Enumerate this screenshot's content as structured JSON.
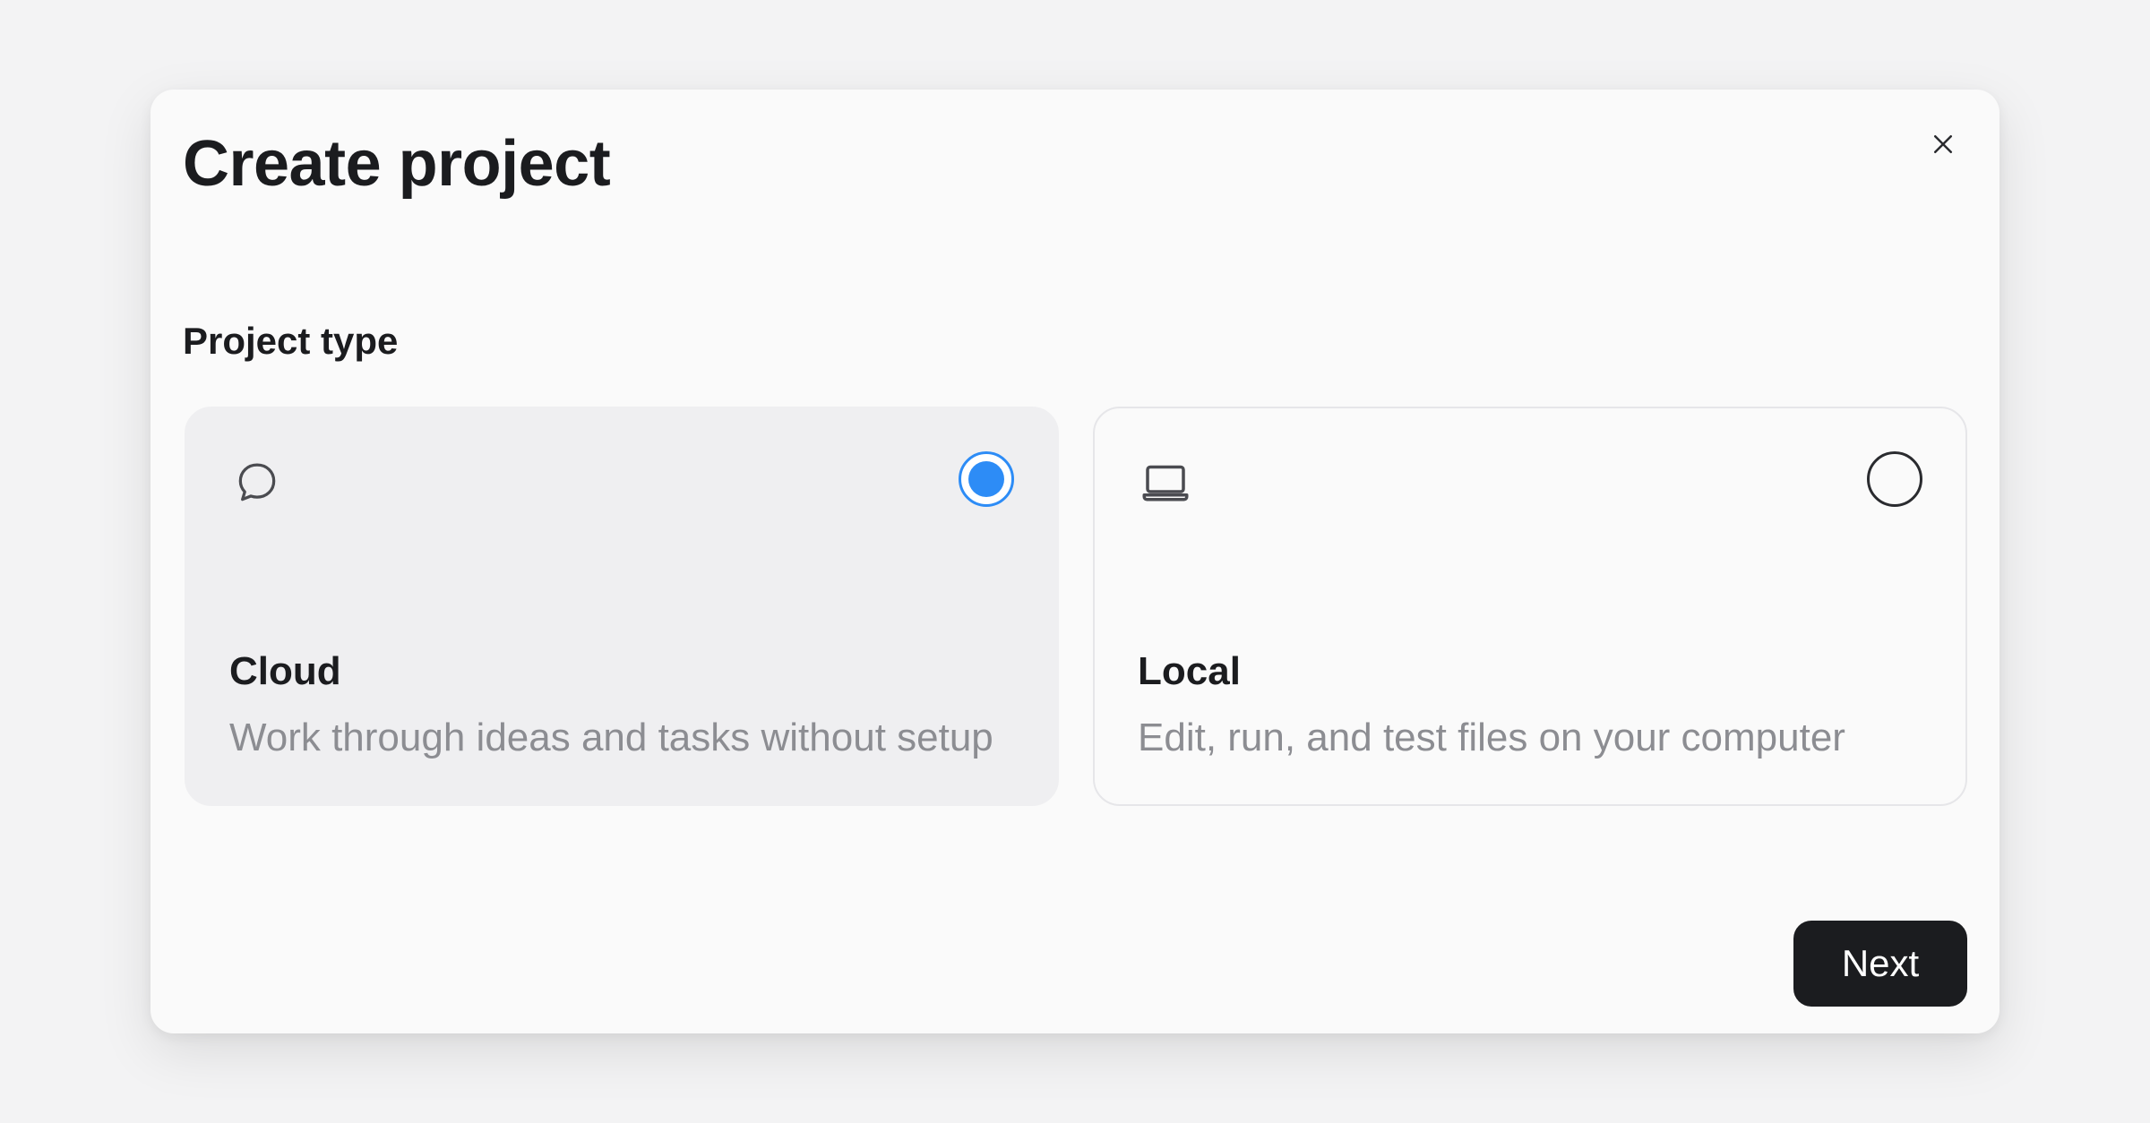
{
  "dialog": {
    "title": "Create project",
    "close_icon": "close-icon",
    "section_label": "Project type",
    "options": [
      {
        "id": "cloud",
        "icon": "chat-bubble-icon",
        "title": "Cloud",
        "description": "Work through ideas and tasks without setup",
        "selected": true
      },
      {
        "id": "local",
        "icon": "laptop-icon",
        "title": "Local",
        "description": "Edit, run, and test files on your computer",
        "selected": false
      }
    ],
    "next_label": "Next"
  },
  "colors": {
    "backdrop": "#f3f3f4",
    "dialog_bg": "#fafafa",
    "selected_card_bg": "#efeff1",
    "accent_blue": "#2d8cf6",
    "primary_button_bg": "#1b1c1f",
    "muted_text": "#8c8d92"
  }
}
